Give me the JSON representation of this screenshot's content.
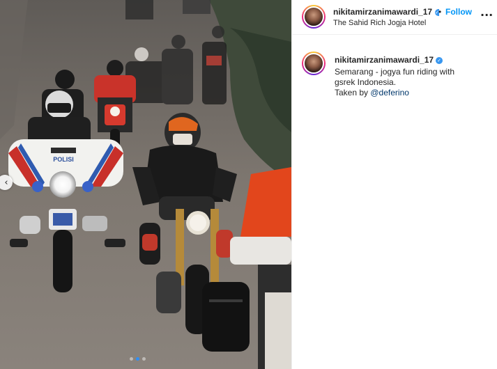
{
  "post": {
    "username": "nikitamirzanimawardi_17",
    "location": "The Sahid Rich Jogja Hotel",
    "follow_label": "Follow",
    "follow_separator": "•",
    "more_label": "...",
    "verified_mark": "✓"
  },
  "caption": {
    "username": "nikitamirzanimawardi_17",
    "line1": "Semarang - jogya fun riding with",
    "line2": "gsrek Indonesia.",
    "line3_prefix": "Taken by ",
    "mention": "@deferino"
  },
  "photo": {
    "police_label": "POLISI",
    "plate_label": "",
    "carousel_prev_icon": "chevron-left-icon",
    "carousel_dot_count": 3,
    "carousel_active_index": 1
  },
  "colors": {
    "follow": "#0095f6",
    "verified": "#3897f0",
    "mention": "#00376b",
    "carousel_active": "#2f8ff5"
  }
}
